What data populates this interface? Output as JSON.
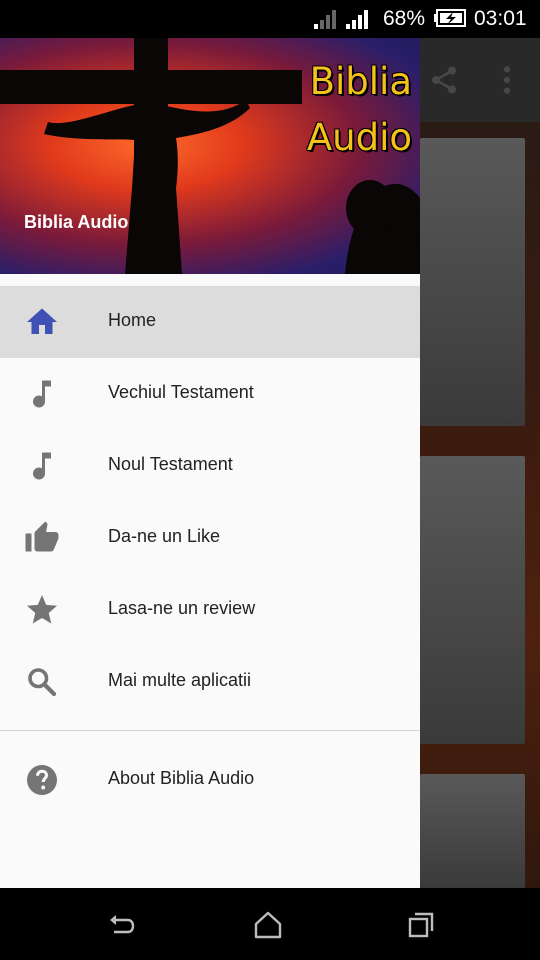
{
  "status_bar": {
    "battery": "68%",
    "time": "03:01"
  },
  "header": {
    "logo_line1": "Biblia",
    "logo_line2": "Audio",
    "title": "Biblia Audio"
  },
  "menu": {
    "items": [
      {
        "label": "Home",
        "icon": "home-icon",
        "active": true
      },
      {
        "label": "Vechiul Testament",
        "icon": "music-note-icon"
      },
      {
        "label": "Noul Testament",
        "icon": "music-note-icon"
      },
      {
        "label": "Da-ne un Like",
        "icon": "thumb-up-icon"
      },
      {
        "label": "Lasa-ne un review",
        "icon": "star-icon"
      },
      {
        "label": "Mai multe aplicatii",
        "icon": "search-icon"
      },
      {
        "label": "About Biblia Audio",
        "icon": "help-icon"
      }
    ]
  },
  "colors": {
    "accent": "#3f51b5",
    "icon_gray": "#757575",
    "logo_yellow": "#f5c21a"
  }
}
